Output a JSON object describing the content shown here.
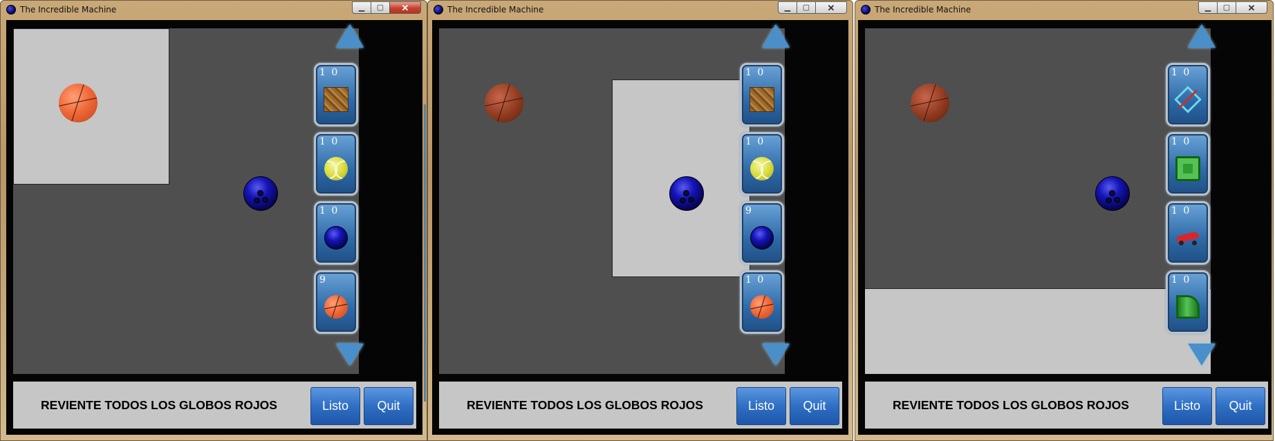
{
  "windows": [
    {
      "title": "The Incredible Machine",
      "inventory": [
        {
          "count": "1 0",
          "item": "wood-crate"
        },
        {
          "count": "1 0",
          "item": "tennis-ball"
        },
        {
          "count": "1 0",
          "item": "bowling-ball"
        },
        {
          "count": "9",
          "item": "basketball"
        }
      ],
      "goal": "REVIENTE TODOS LOS GLOBOS ROJOS",
      "listo_label": "Listo",
      "quit_label": "Quit"
    },
    {
      "title": "The Incredible Machine",
      "inventory": [
        {
          "count": "1 0",
          "item": "wood-crate"
        },
        {
          "count": "1 0",
          "item": "tennis-ball"
        },
        {
          "count": "9",
          "item": "bowling-ball"
        },
        {
          "count": "1 0",
          "item": "basketball"
        }
      ],
      "goal": "REVIENTE TODOS LOS GLOBOS ROJOS",
      "listo_label": "Listo",
      "quit_label": "Quit"
    },
    {
      "title": "The Incredible Machine",
      "inventory": [
        {
          "count": "1 0",
          "item": "bow-arrow"
        },
        {
          "count": "1 0",
          "item": "green-pipe-square"
        },
        {
          "count": "1 0",
          "item": "red-toy-car"
        },
        {
          "count": "1 0",
          "item": "green-pipe-elbow"
        }
      ],
      "goal": "REVIENTE TODOS LOS GLOBOS ROJOS",
      "listo_label": "Listo",
      "quit_label": "Quit"
    }
  ],
  "colors": {
    "play_area": "#4f4f4f",
    "drop_zone": "#c6c6c6",
    "button_blue": "#2f6fc4"
  }
}
